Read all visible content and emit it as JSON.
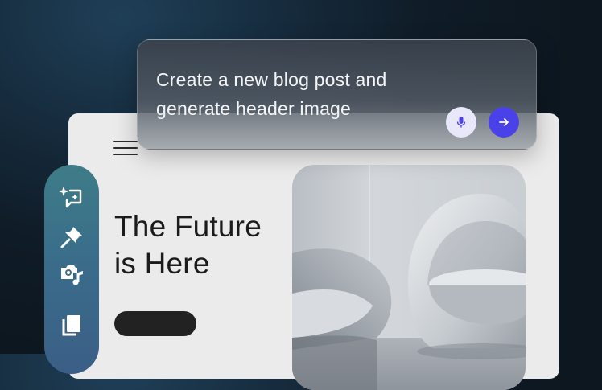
{
  "prompt": {
    "line1": "Create a new blog post and",
    "line2": "generate header image",
    "mic_icon": "microphone-icon",
    "send_icon": "arrow-right-icon"
  },
  "hero": {
    "title_line1": "The Future",
    "title_line2": "is Here",
    "cta_label": ""
  },
  "toolbar": {
    "items": [
      "ai-sparkle-icon",
      "pin-icon",
      "media-icon",
      "copy-icon"
    ]
  },
  "colors": {
    "accent": "#4a42e8",
    "mic_bg": "#e9e8fb",
    "card_bg": "#ebebeb",
    "title_text": "#1b1b1b"
  }
}
